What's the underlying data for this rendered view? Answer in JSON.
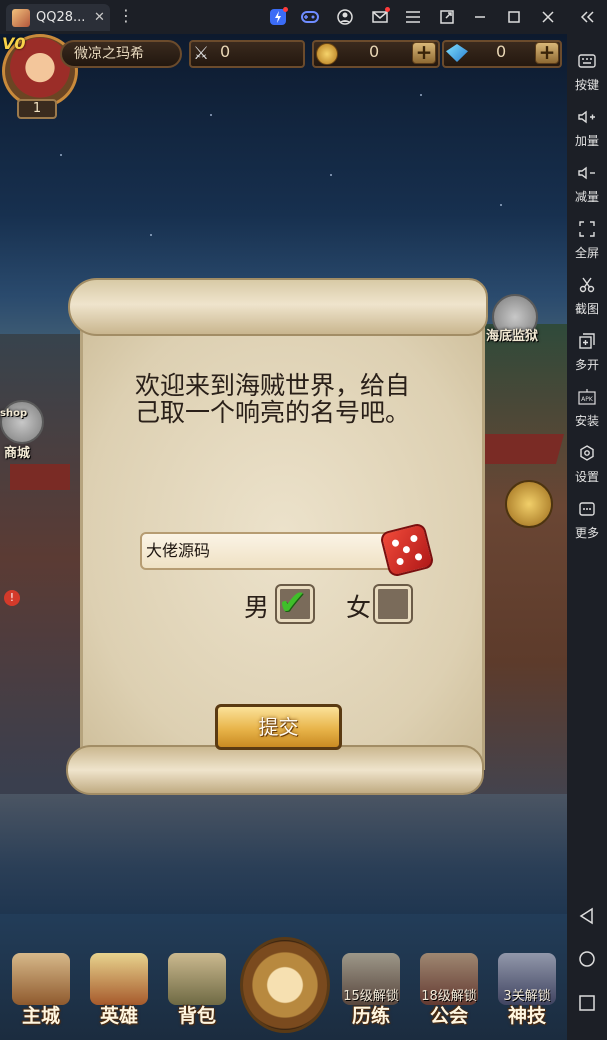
{
  "window": {
    "tab_title": "QQ28...",
    "tab_close": "✕",
    "more": "⋮",
    "controls": [
      "⚡",
      "🎮",
      "◉",
      "✉",
      "☰",
      "⧉",
      "—",
      "☐",
      "✕",
      "«"
    ]
  },
  "sidebar": {
    "items": [
      {
        "label": "按键",
        "icon": "keyboard-icon"
      },
      {
        "label": "加量",
        "icon": "volume-up-icon"
      },
      {
        "label": "减量",
        "icon": "volume-down-icon"
      },
      {
        "label": "全屏",
        "icon": "fullscreen-icon"
      },
      {
        "label": "截图",
        "icon": "scissors-icon"
      },
      {
        "label": "多开",
        "icon": "multi-instance-icon"
      },
      {
        "label": "安装",
        "icon": "apk-install-icon"
      },
      {
        "label": "设置",
        "icon": "gear-icon"
      },
      {
        "label": "更多",
        "icon": "more-icon"
      }
    ],
    "nav": [
      "back-icon",
      "home-icon",
      "recent-apps-icon"
    ]
  },
  "hud": {
    "vip": "V0",
    "level": "1",
    "player_name": "微凉之玛希",
    "power": "0",
    "coins": "0",
    "gems": "0",
    "plus": "+"
  },
  "map": {
    "left_shop_label": "商城",
    "left_shop_badge": "shop",
    "right_prison_label": "海底监狱"
  },
  "dialog": {
    "welcome_text": "欢迎来到海贼世界，给自己取一个响亮的名号吧。",
    "name_value": "大佬源码",
    "male_label": "男",
    "female_label": "女",
    "male_checked": true,
    "female_checked": false,
    "submit_label": "提交"
  },
  "bottom_nav": [
    {
      "label": "主城",
      "lock": ""
    },
    {
      "label": "英雄",
      "lock": ""
    },
    {
      "label": "背包",
      "lock": ""
    },
    {
      "label": "历练",
      "lock": "15级解锁"
    },
    {
      "label": "公会",
      "lock": "18级解锁"
    },
    {
      "label": "神技",
      "lock": "3关解锁"
    }
  ],
  "colors": {
    "accent_gold": "#e8b44a",
    "parchment": "#ece2cb",
    "check_green": "#3fbf2a",
    "dice_red": "#d42a22"
  }
}
